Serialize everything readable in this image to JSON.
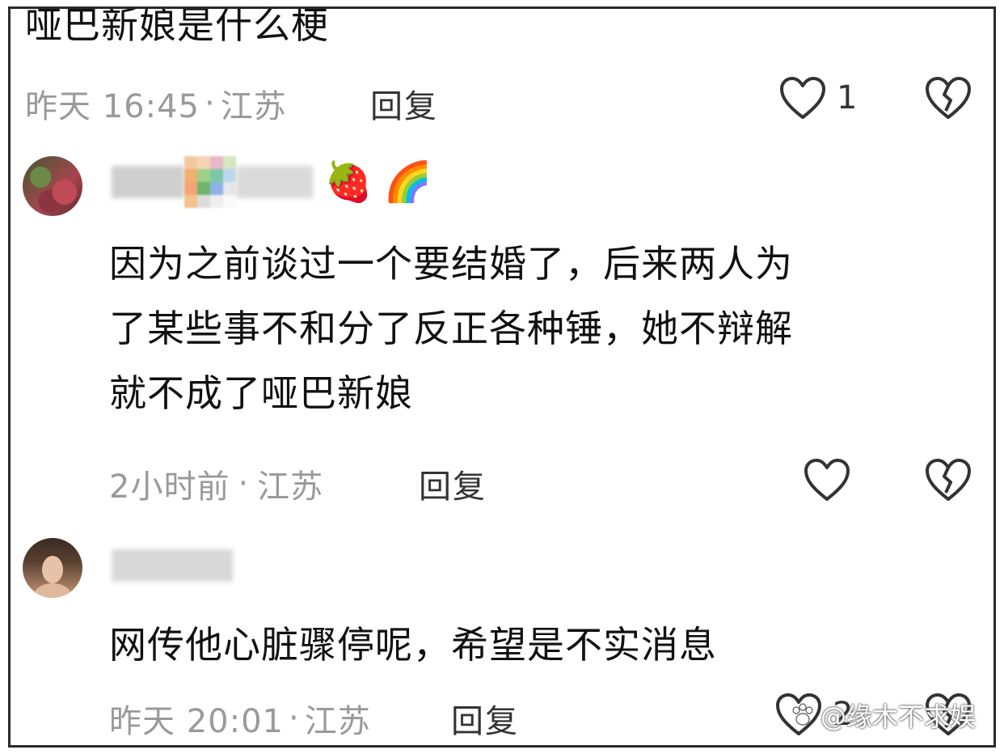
{
  "top_comment": {
    "text": "哑巴新娘是什么梗",
    "time": "昨天 16:45",
    "location": "江苏",
    "reply_label": "回复",
    "likes": "1"
  },
  "comments": [
    {
      "emoji_1": "🍓",
      "emoji_2": "🌈",
      "text_line_1": "因为之前谈过一个要结婚了，后来两人为",
      "text_line_2": "了某些事不和分了反正各种锤，她不辩解",
      "text_line_3": "就不成了哑巴新娘",
      "time": "2小时前",
      "location": "江苏",
      "reply_label": "回复"
    },
    {
      "text_line_1": "网传他心脏骤停呢，希望是不实消息",
      "time": "昨天 20:01",
      "location": "江苏",
      "reply_label": "回复",
      "likes": "2"
    }
  ],
  "separator": "·",
  "watermark": "@缘木不求娱",
  "icons": {
    "like": "heart-outline-icon",
    "dislike": "broken-heart-icon",
    "watermark": "paw-icon"
  },
  "colors": {
    "text": "#111111",
    "meta": "#9a9a9a",
    "icon": "#333333"
  }
}
